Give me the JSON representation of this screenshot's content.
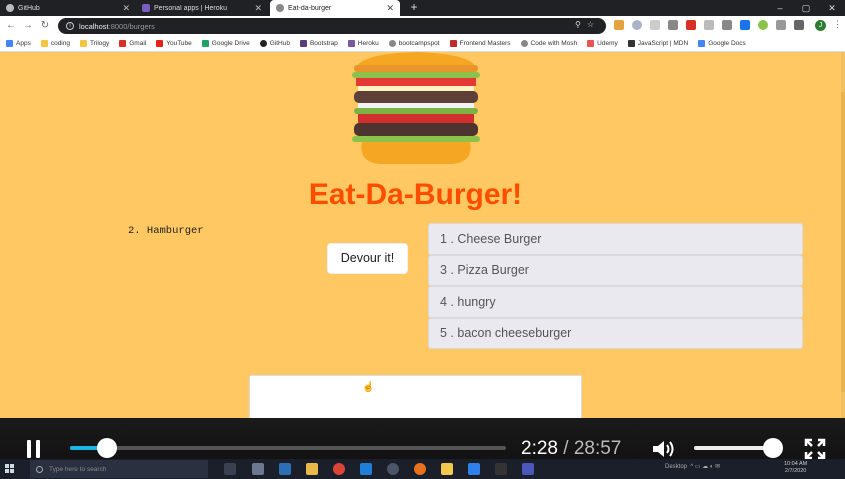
{
  "browser": {
    "tabs": [
      {
        "title": "GitHub",
        "color": "#bbbbbb",
        "active": false
      },
      {
        "title": "Personal apps | Heroku",
        "color": "#7b5cc2",
        "active": false
      },
      {
        "title": "Eat-da-burger",
        "color": "#888888",
        "active": true
      }
    ],
    "new_tab": "+",
    "window_controls": [
      "–",
      "▢",
      "✕"
    ],
    "url": {
      "host": "localhost",
      "rest": ":8000/burgers"
    },
    "avatar_letter": "J"
  },
  "bookmarks": [
    {
      "label": "Apps",
      "color": "#4285f4"
    },
    {
      "label": "coding",
      "color": "#f4c542"
    },
    {
      "label": "Trilogy",
      "color": "#f4c542"
    },
    {
      "label": "Gmail",
      "color": "#d93025"
    },
    {
      "label": "YouTube",
      "color": "#e62117"
    },
    {
      "label": "Google Drive",
      "color": "#1fa463"
    },
    {
      "label": "GitHub",
      "color": "#222222"
    },
    {
      "label": "Bootstrap",
      "color": "#563d7c"
    },
    {
      "label": "Heroku",
      "color": "#79589f"
    },
    {
      "label": "bootcampspot",
      "color": "#888888"
    },
    {
      "label": "Frontend Masters",
      "color": "#c02d28"
    },
    {
      "label": "Code with Mosh",
      "color": "#888888"
    },
    {
      "label": "Udemy",
      "color": "#ec5252"
    },
    {
      "label": "JavaScript | MDN",
      "color": "#333333"
    },
    {
      "label": "Google Docs",
      "color": "#4285f4"
    }
  ],
  "page": {
    "title": "Eat-Da-Burger!",
    "eaten_burger": "2. Hamburger",
    "devour_button": "Devour it!",
    "burgers": [
      "1 . Cheese Burger",
      "3 . Pizza Burger",
      "4 . hungry",
      "5 . bacon cheeseburger"
    ],
    "colors": {
      "background": "#ffc862",
      "title": "#ff4d00"
    }
  },
  "video": {
    "current_time": "2:28",
    "separator": "/",
    "duration": "28:57",
    "progress_fraction": 0.085,
    "volume_fraction": 0.92,
    "accent": "#19b6e6"
  },
  "taskbar": {
    "search_placeholder": "Type here to search",
    "tray_text": "Desktop",
    "clock_time": "10:04 AM",
    "clock_date": "2/7/2020"
  }
}
